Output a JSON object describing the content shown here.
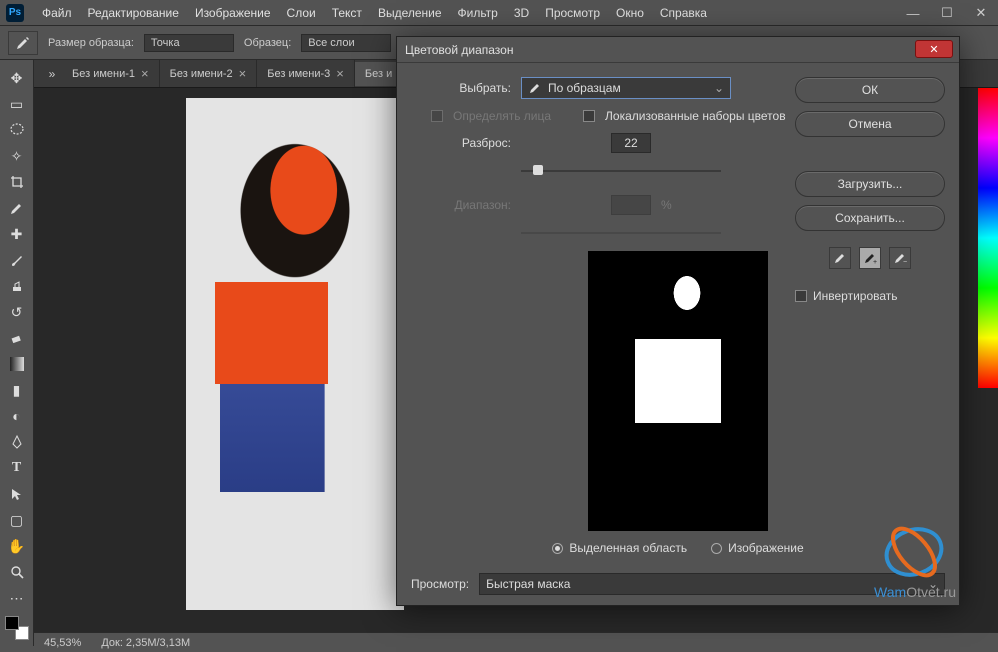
{
  "menubar": {
    "items": [
      "Файл",
      "Редактирование",
      "Изображение",
      "Слои",
      "Текст",
      "Выделение",
      "Фильтр",
      "3D",
      "Просмотр",
      "Окно",
      "Справка"
    ]
  },
  "window_controls": {
    "min": "—",
    "max": "☐",
    "close": "✕"
  },
  "optionsbar": {
    "sample_label": "Размер образца:",
    "sample_value": "Точка",
    "sample2_label": "Образец:",
    "sample2_value": "Все слои"
  },
  "tabs": {
    "items": [
      {
        "label": "Без имени-1",
        "active": false
      },
      {
        "label": "Без имени-2",
        "active": false
      },
      {
        "label": "Без имени-3",
        "active": false
      },
      {
        "label": "Без и",
        "active": true
      }
    ]
  },
  "statusbar": {
    "zoom": "45,53%",
    "doc": "Док: 2,35M/3,13M"
  },
  "dialog": {
    "title": "Цветовой диапазон",
    "select_label": "Выбрать:",
    "select_value": "По образцам",
    "detect_faces": "Определять лица",
    "localized": "Локализованные наборы цветов",
    "fuzziness_label": "Разброс:",
    "fuzziness_value": "22",
    "range_label": "Диапазон:",
    "range_unit": "%",
    "radio_selection": "Выделенная область",
    "radio_image": "Изображение",
    "preview_label": "Просмотр:",
    "preview_value": "Быстрая маска",
    "buttons": {
      "ok": "ОК",
      "cancel": "Отмена",
      "load": "Загрузить...",
      "save": "Сохранить..."
    },
    "invert": "Инвертировать",
    "eyedroppers": [
      "sample",
      "add",
      "subtract"
    ]
  },
  "watermark": {
    "text_prefix": "Wam",
    "text_suffix": "Otvet.ru"
  },
  "colors": {
    "accent": "#e84a1a",
    "denim": "#3a4f9c",
    "ps_blue": "#31a8ff",
    "dlg_border_sel": "#6a8fc5"
  }
}
